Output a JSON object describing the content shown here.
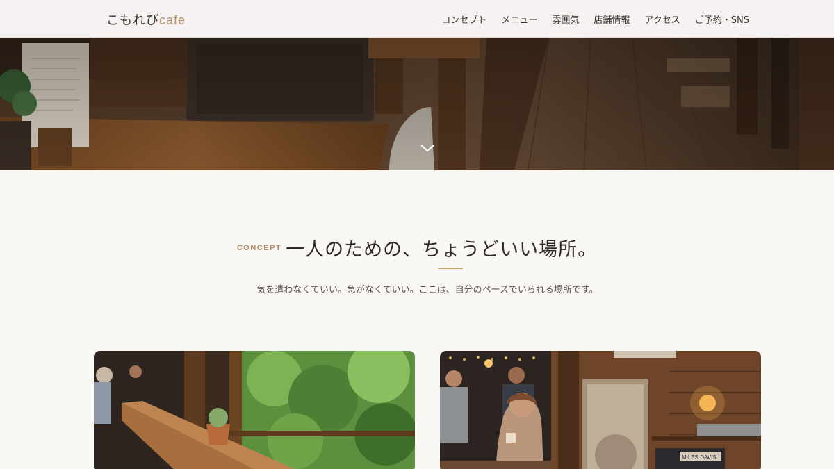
{
  "header": {
    "logo_jp": "こもれび",
    "logo_en": "cafe",
    "nav": [
      "コンセプト",
      "メニュー",
      "雰囲気",
      "店舗情報",
      "アクセス",
      "ご予約・SNS"
    ]
  },
  "hero": {
    "image": "cafe-interior-photo",
    "scroll_icon": "chevron-down-icon"
  },
  "concept": {
    "label": "CONCEPT",
    "title": "一人のための、ちょうどいい場所。",
    "body": "気を遣わなくていい。急がなくていい。ここは、自分のペースでいられる場所です。"
  },
  "cards": [
    {
      "image": "window-counter-plants-photo"
    },
    {
      "image": "woman-reading-with-coffee-photo",
      "label": "MILES DAVIS"
    }
  ],
  "colors": {
    "accent": "#b58a60",
    "text": "#2f2a27",
    "background": "#faf8f4"
  }
}
